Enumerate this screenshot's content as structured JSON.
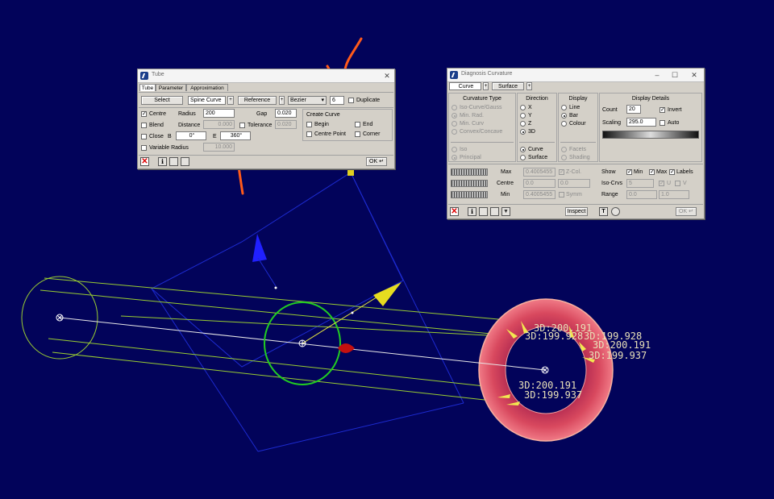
{
  "scene": {
    "labels": [
      "3D:200.191",
      "3D:199.928",
      "3D:199.928",
      "3D:200.191",
      "3D:199.937",
      "3D:200.191",
      "3D:199.937"
    ]
  },
  "tube": {
    "title": "Tube",
    "tabs": [
      "Tube",
      "Parameter",
      "Approximation"
    ],
    "select": "Select",
    "spine": "Spine Curve",
    "reference": "Reference",
    "bezier": "Bezier",
    "degree": "6",
    "duplicate": "Duplicate",
    "centre": "Centre",
    "radius_label": "Radius",
    "radius": "200",
    "gap_label": "Gap",
    "gap": "0.020",
    "blend": "Blend",
    "distance_label": "Distance",
    "distance": "0.000",
    "tolerance": "Tolerance",
    "tolerance_value": "0.020",
    "close": "Close",
    "b_label": "B",
    "b_value": "0°",
    "e_label": "E",
    "e_value": "360°",
    "variable_radius": "Variable Radius",
    "variable_value": "10.000",
    "create_curve": "Create Curve",
    "begin": "Begin",
    "end": "End",
    "centre_point": "Centre Point",
    "corner": "Corner",
    "ok": "OK"
  },
  "diag": {
    "title": "Diagnosis Curvature",
    "tab_curve": "Curve",
    "tab_surface": "Surface",
    "curvature_type": "Curvature Type",
    "types": [
      "Iso-Curve/Gauss",
      "Min. Rad.",
      "Min. Curv",
      "Convex/Concave"
    ],
    "iso": "Iso",
    "principal": "Principal",
    "direction": "Direction",
    "directions": [
      "X",
      "Y",
      "Z",
      "3D"
    ],
    "curve": "Curve",
    "surface": "Surface",
    "display": "Display",
    "displays": [
      "Line",
      "Bar",
      "Colour"
    ],
    "facets": "Facets",
    "shading": "Shading",
    "display_details": "Display Details",
    "count_label": "Count",
    "count": "20",
    "invert": "Invert",
    "scaling_label": "Scaling",
    "scaling": "295.0",
    "auto": "Auto",
    "max_label": "Max",
    "max_value": "0.4005455",
    "zcol": "Z-Col.",
    "centre_label": "Centre",
    "centre_value": "0.0",
    "centre_value2": "0.0",
    "min_label": "Min",
    "min_value": "0.4005455",
    "symm": "Symm",
    "show_label": "Show",
    "show_min": "Min",
    "show_max": "Max",
    "show_labels": "Labels",
    "iso_crvs_label": "Iso-Crvs",
    "iso_crvs": "5",
    "u": "U",
    "v": "V",
    "range_label": "Range",
    "range_min": "0.0",
    "range_max": "1.0",
    "inspect": "Inspect",
    "ok": "OK"
  },
  "colors": {
    "background": "#02035a",
    "curve_green": "#9acd32",
    "circle_green": "#22cc22",
    "disk_pink": "#e0506a",
    "annotation_orange": "#ff5a1a"
  }
}
